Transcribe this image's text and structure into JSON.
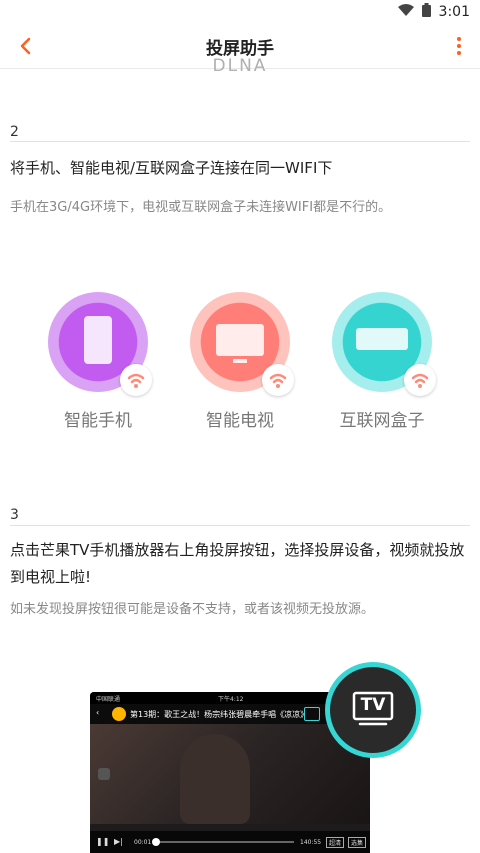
{
  "status_bar": {
    "time": "3:01"
  },
  "app_bar": {
    "title": "投屏助手"
  },
  "partial_text": "DLNA",
  "step2": {
    "number": "2",
    "instruction": "将手机、智能电视/互联网盒子连接在同一WIFI下",
    "note": "手机在3G/4G环境下，电视或互联网盒子未连接WIFI都是不行的。"
  },
  "devices": [
    {
      "label": "智能手机",
      "color_start": "#c25bf0",
      "color_end": "#8e3bdc",
      "ring": "#d9a2f5"
    },
    {
      "label": "智能电视",
      "color_start": "#ff8d86",
      "color_end": "#ff6c66",
      "ring": "#ffc3be"
    },
    {
      "label": "互联网盒子",
      "color_start": "#52e0dc",
      "color_end": "#25c3c2",
      "ring": "#a5eeed"
    }
  ],
  "step3": {
    "number": "3",
    "instruction": "点击芒果TV手机播放器右上角投屏按钮，选择投屏设备，视频就投放到电视上啦!",
    "note": "如未发现投屏按钮很可能是设备不支持，或者该视频无投放源。"
  },
  "player": {
    "carrier": "中国联通",
    "clock": "下午4:12",
    "episode_title": "第13期：歌王之战！杨宗纬张碧晨牵手唱《凉凉》",
    "time_current": "00:01",
    "time_total": "140:55",
    "quality": "超清",
    "episodes": "选集"
  },
  "tv_fab": {
    "label": "TV"
  },
  "colors": {
    "accent": "#ff5f1f",
    "cast_ring": "#35d6d4"
  }
}
